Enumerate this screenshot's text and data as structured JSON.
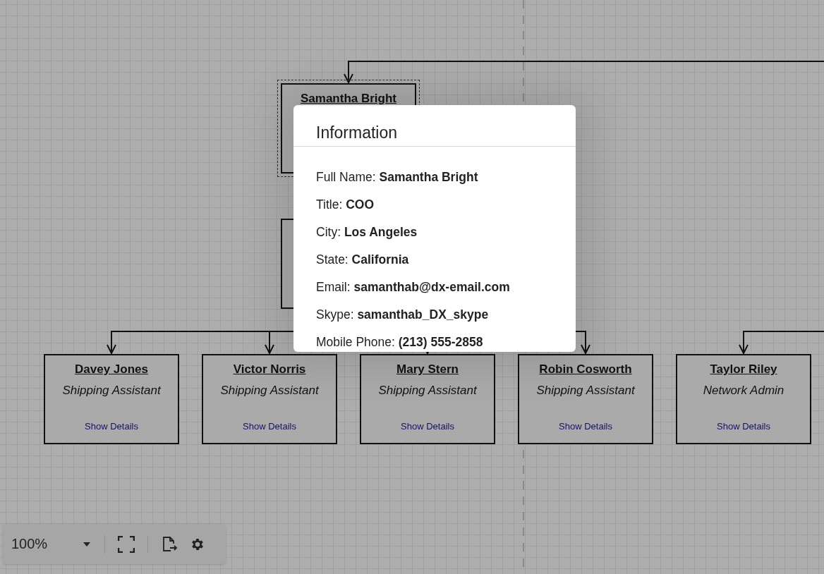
{
  "diagram": {
    "nodes": [
      {
        "name": "Samantha Bright",
        "selected": true
      },
      {
        "selected": false
      },
      {
        "name": "Davey Jones",
        "title": "Shipping Assistant",
        "link": "Show Details",
        "selected": false
      },
      {
        "name": "Victor Norris",
        "title": "Shipping Assistant",
        "link": "Show Details",
        "selected": false
      },
      {
        "name": "Mary Stern",
        "title": "Shipping Assistant",
        "link": "Show Details",
        "selected": false
      },
      {
        "name": "Robin Cosworth",
        "title": "Shipping Assistant",
        "link": "Show Details",
        "selected": false
      },
      {
        "name": "Taylor Riley",
        "title": "Network Admin",
        "link": "Show Details",
        "selected": false
      }
    ]
  },
  "dialog": {
    "title": "Information",
    "fields": [
      {
        "label": "Full Name:",
        "value": "Samantha Bright"
      },
      {
        "label": "Title:",
        "value": "COO"
      },
      {
        "label": "City:",
        "value": "Los Angeles"
      },
      {
        "label": "State:",
        "value": "California"
      },
      {
        "label": "Email:",
        "value": "samanthab@dx-email.com"
      },
      {
        "label": "Skype:",
        "value": "samanthab_DX_skype"
      },
      {
        "label": "Mobile Phone:",
        "value": "(213) 555-2858"
      }
    ]
  },
  "toolbar": {
    "zoom": "100%"
  }
}
